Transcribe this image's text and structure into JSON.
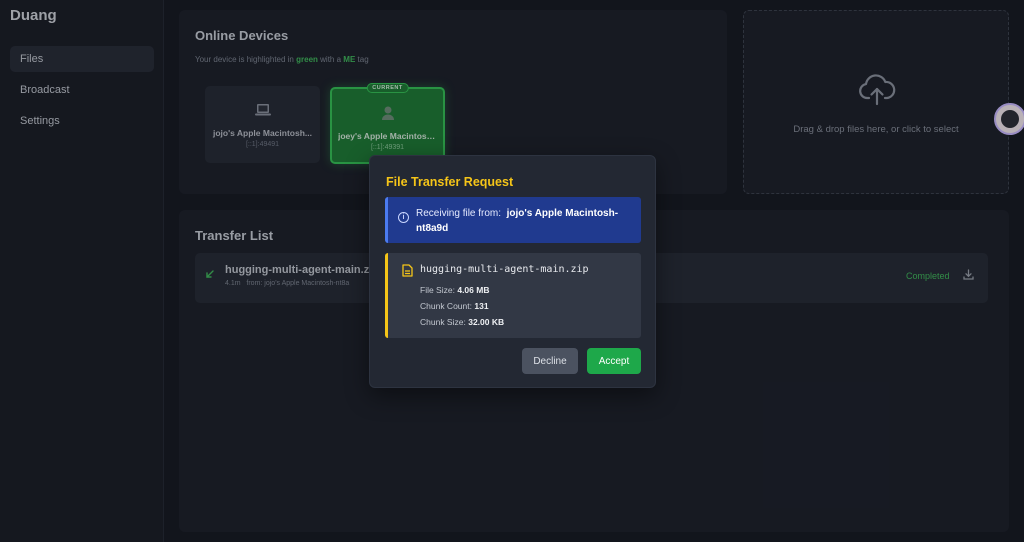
{
  "app": {
    "title": "Duang"
  },
  "sidebar": {
    "items": [
      {
        "label": "Files",
        "active": true
      },
      {
        "label": "Broadcast",
        "active": false
      },
      {
        "label": "Settings",
        "active": false
      }
    ]
  },
  "devices": {
    "title": "Online Devices",
    "hint_prefix": "Your device is highlighted in",
    "hint_green": "green",
    "hint_middle": "with a",
    "hint_me": "ME",
    "hint_suffix": "tag",
    "items": [
      {
        "name": "jojo's Apple Macintosh...",
        "address": "[::1]:49491",
        "icon": "laptop-icon",
        "current": false
      },
      {
        "name": "joey's Apple Macintosh...",
        "address": "[::1]:49391",
        "icon": "user-icon",
        "current": true,
        "badge": "CURRENT"
      }
    ]
  },
  "dropzone": {
    "text": "Drag & drop files here, or click to select",
    "icon": "upload-cloud-icon"
  },
  "transfers": {
    "title": "Transfer List",
    "items": [
      {
        "file": "hugging-multi-agent-main.zip",
        "size": "4.1m",
        "from": "from: jojo's Apple Macintosh-nt8a",
        "status": "Completed"
      }
    ]
  },
  "modal": {
    "title": "File Transfer Request",
    "receiving_label": "Receiving file from:",
    "sender": "jojo's Apple Macintosh-nt8a9d",
    "file_name": "hugging-multi-agent-main.zip",
    "file_size_label": "File Size:",
    "file_size": "4.06 MB",
    "chunk_count_label": "Chunk Count:",
    "chunk_count": "131",
    "chunk_size_label": "Chunk Size:",
    "chunk_size": "32.00 KB",
    "decline_label": "Decline",
    "accept_label": "Accept"
  },
  "colors": {
    "accent_green": "#1ea84a",
    "warning_yellow": "#f5c518",
    "info_blue": "#203a8f"
  }
}
